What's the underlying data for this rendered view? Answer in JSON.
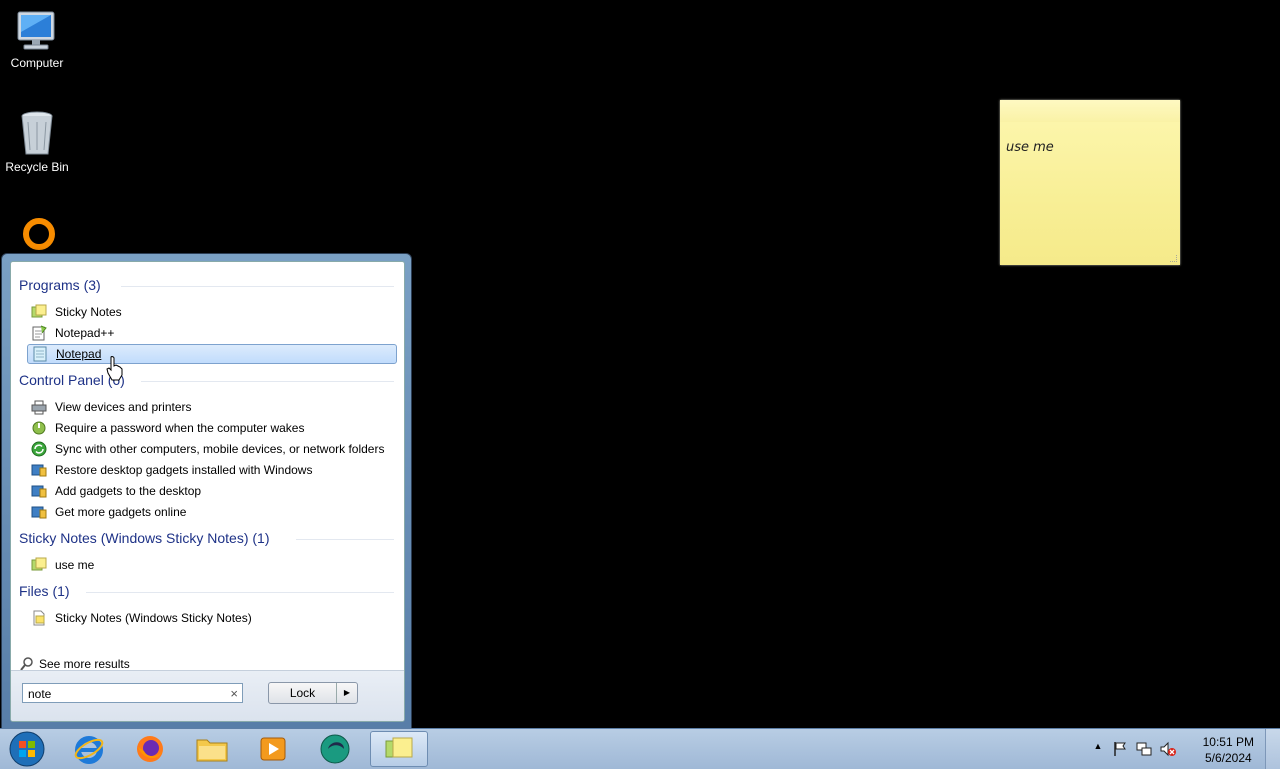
{
  "desktop": {
    "icons": [
      {
        "label": "Computer",
        "icon": "computer-icon"
      },
      {
        "label": "Recycle Bin",
        "icon": "recycle-bin-icon"
      },
      {
        "label": "",
        "icon": "app-orange-ring-icon"
      }
    ]
  },
  "sticky_note": {
    "text": "use me"
  },
  "start_menu": {
    "groups": [
      {
        "title": "Programs (3)",
        "items": [
          {
            "label": "Sticky Notes",
            "icon": "sticky-notes-icon"
          },
          {
            "label": "Notepad++",
            "icon": "notepad-plus-plus-icon"
          },
          {
            "label": "Notepad",
            "icon": "notepad-icon",
            "selected": true
          }
        ]
      },
      {
        "title": "Control Panel (6)",
        "items": [
          {
            "label": "View devices and printers",
            "icon": "devices-printers-icon"
          },
          {
            "label": "Require a password when the computer wakes",
            "icon": "power-options-icon"
          },
          {
            "label": "Sync with other computers, mobile devices, or network folders",
            "icon": "sync-center-icon"
          },
          {
            "label": "Restore desktop gadgets installed with Windows",
            "icon": "gadgets-icon"
          },
          {
            "label": "Add gadgets to the desktop",
            "icon": "gadgets-icon"
          },
          {
            "label": "Get more gadgets online",
            "icon": "gadgets-icon"
          }
        ]
      },
      {
        "title": "Sticky Notes (Windows Sticky Notes) (1)",
        "items": [
          {
            "label": "use me",
            "icon": "sticky-notes-icon"
          }
        ]
      },
      {
        "title": "Files (1)",
        "items": [
          {
            "label": "Sticky Notes (Windows Sticky Notes)",
            "icon": "file-icon"
          }
        ]
      }
    ],
    "see_more": "See more results",
    "search_value": "note",
    "search_clear": "×",
    "lock_label": "Lock",
    "lock_arrow": "▶"
  },
  "taskbar": {
    "items": [
      "start-orb-icon",
      "internet-explorer-icon",
      "firefox-icon",
      "file-explorer-icon",
      "media-player-icon",
      "app-green-icon",
      "sticky-notes-icon"
    ],
    "tray": {
      "overflow": "▲",
      "time": "10:51 PM",
      "date": "5/6/2024"
    }
  }
}
